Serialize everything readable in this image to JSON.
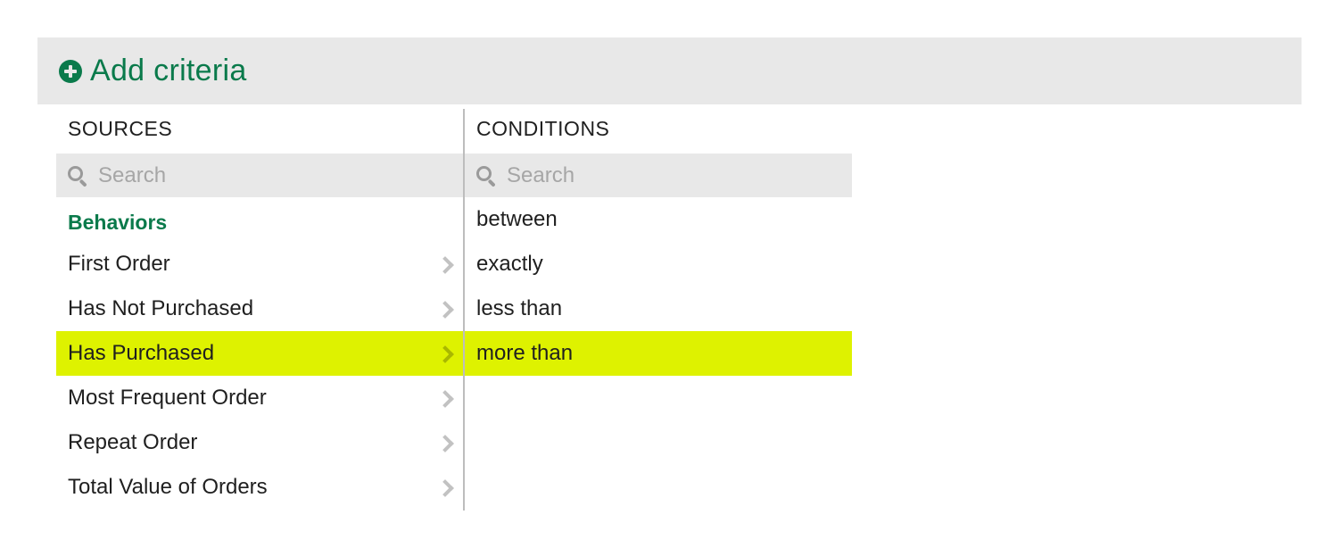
{
  "colors": {
    "accent": "#0a7a4b",
    "highlight": "#def200",
    "header_bg": "#e8e8e8"
  },
  "header": {
    "add_label": "Add criteria",
    "add_icon": "plus-circle-icon"
  },
  "sources": {
    "title": "SOURCES",
    "search_placeholder": "Search",
    "group_label": "Behaviors",
    "items": [
      {
        "label": "First Order",
        "selected": false
      },
      {
        "label": "Has Not Purchased",
        "selected": false
      },
      {
        "label": "Has Purchased",
        "selected": true
      },
      {
        "label": "Most Frequent Order",
        "selected": false
      },
      {
        "label": "Repeat Order",
        "selected": false
      },
      {
        "label": "Total Value of Orders",
        "selected": false
      }
    ]
  },
  "conditions": {
    "title": "CONDITIONS",
    "search_placeholder": "Search",
    "items": [
      {
        "label": "between",
        "selected": false
      },
      {
        "label": "exactly",
        "selected": false
      },
      {
        "label": "less than",
        "selected": false
      },
      {
        "label": "more than",
        "selected": true
      }
    ]
  }
}
